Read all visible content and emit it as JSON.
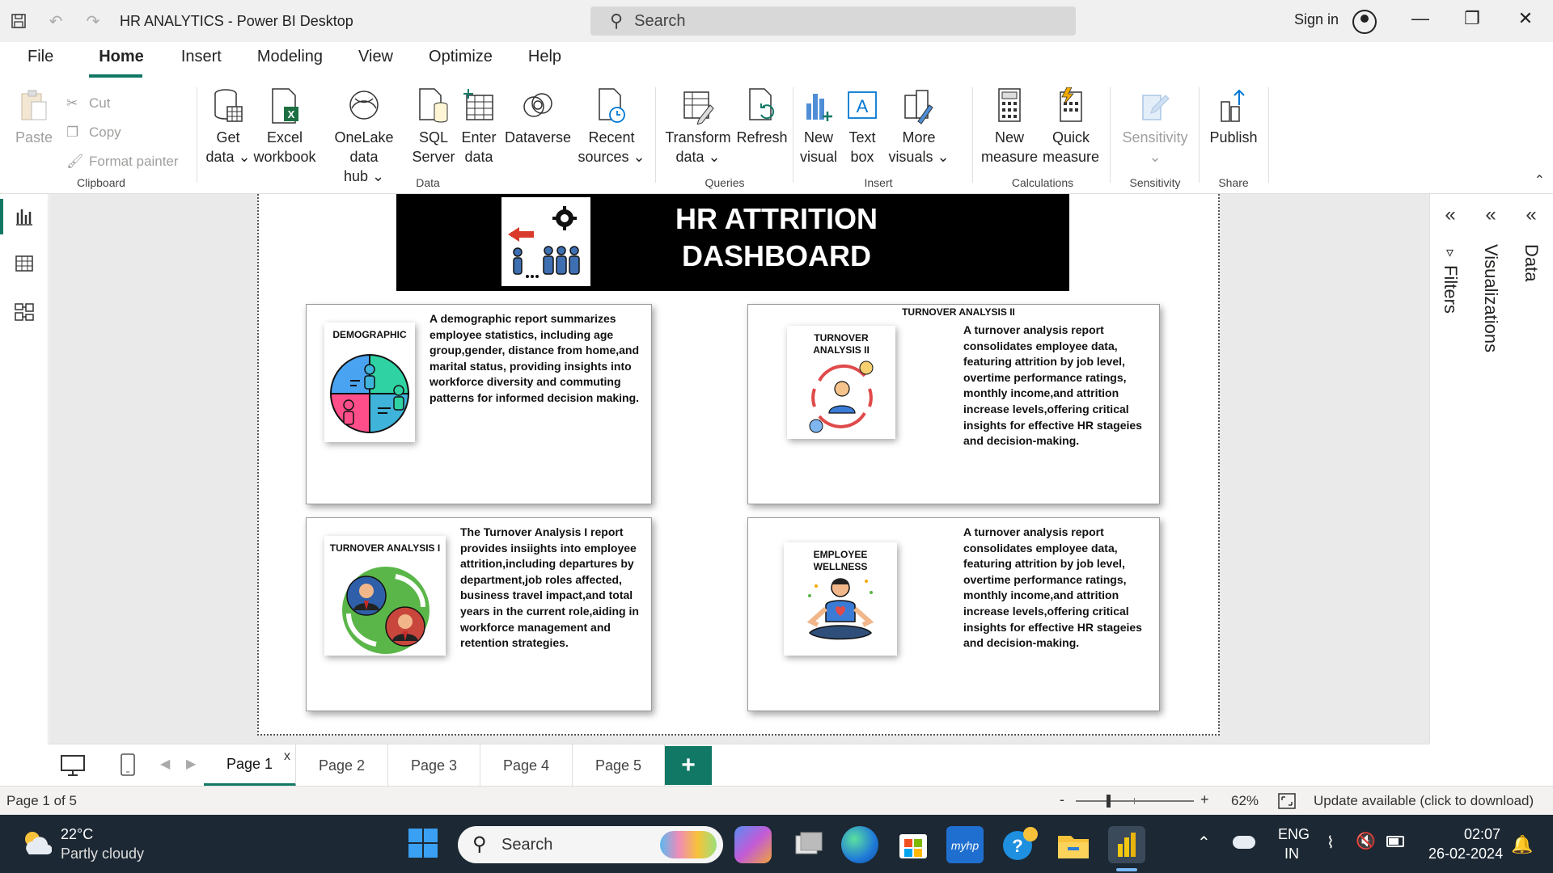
{
  "window": {
    "title": "HR ANALYTICS - Power BI Desktop",
    "search_placeholder": "Search",
    "sign_in": "Sign in"
  },
  "menu": {
    "items": [
      "File",
      "Home",
      "Insert",
      "Modeling",
      "View",
      "Optimize",
      "Help"
    ],
    "active": "Home"
  },
  "ribbon": {
    "clipboard": {
      "paste": "Paste",
      "cut": "Cut",
      "copy": "Copy",
      "format_painter": "Format painter",
      "label": "Clipboard"
    },
    "data": {
      "get_data": [
        "Get",
        "data ⌄"
      ],
      "excel": [
        "Excel",
        "workbook"
      ],
      "onelake": [
        "OneLake data",
        "hub ⌄"
      ],
      "sql": [
        "SQL",
        "Server"
      ],
      "enter": [
        "Enter",
        "data"
      ],
      "dataverse": [
        "Dataverse",
        ""
      ],
      "recent": [
        "Recent",
        "sources ⌄"
      ],
      "label": "Data"
    },
    "queries": {
      "transform": [
        "Transform",
        "data ⌄"
      ],
      "refresh": [
        "Refresh",
        ""
      ],
      "label": "Queries"
    },
    "insert": {
      "new_visual": [
        "New",
        "visual"
      ],
      "text_box": [
        "Text",
        "box"
      ],
      "more_visuals": [
        "More",
        "visuals ⌄"
      ],
      "label": "Insert"
    },
    "calculations": {
      "new_measure": [
        "New",
        "measure"
      ],
      "quick_measure": [
        "Quick",
        "measure"
      ],
      "label": "Calculations"
    },
    "sensitivity": {
      "button": [
        "Sensitivity",
        "⌄"
      ],
      "label": "Sensitivity"
    },
    "share": {
      "publish": [
        "Publish",
        ""
      ],
      "label": "Share"
    }
  },
  "dashboard": {
    "title_line1": "HR ATTRITION",
    "title_line2": "DASHBOARD",
    "cards": [
      {
        "label": "DEMOGRAPHIC",
        "top_label": "",
        "text": "A demographic report summarizes employee statistics, including age group,gender, distance from home,and marital status, providing insights into workforce diversity and commuting patterns for informed decision making."
      },
      {
        "label": "TURNOVER ANALYSIS II",
        "top_label": "TURNOVER ANALYSIS II",
        "text": "A turnover analysis report consolidates employee data, featuring attrition by job level, overtime performance ratings, monthly income,and attrition increase levels,offering critical insights for effective HR stageies and decision-making."
      },
      {
        "label": "TURNOVER ANALYSIS I",
        "top_label": "",
        "text": "The Turnover Analysis I report provides insiights into employee attrition,including departures by department,job roles affected, business travel impact,and total years in the current role,aiding in workforce management and retention strategies."
      },
      {
        "label": "EMPLOYEE WELLNESS",
        "top_label": "",
        "text": "A turnover analysis report consolidates employee data, featuring attrition by job level, overtime performance ratings, monthly income,and attrition increase levels,offering critical insights for effective HR stageies and decision-making."
      }
    ]
  },
  "panes": {
    "filters": "Filters",
    "visualizations": "Visualizations",
    "data": "Data"
  },
  "pages": {
    "tabs": [
      "Page 1",
      "Page 2",
      "Page 3",
      "Page 4",
      "Page 5"
    ],
    "active": 0,
    "close": "x",
    "add": "+"
  },
  "status": {
    "page_info": "Page 1 of 5",
    "zoom_minus": "-",
    "zoom_plus": "+",
    "zoom": "62%",
    "update": "Update available (click to download)"
  },
  "taskbar": {
    "temp": "22°C",
    "weather": "Partly cloudy",
    "search": "Search",
    "lang1": "ENG",
    "lang2": "IN",
    "time": "02:07",
    "date": "26-02-2024"
  },
  "colors": {
    "accent": "#117865",
    "banner": "#000000",
    "taskbar": "#1c2833"
  }
}
